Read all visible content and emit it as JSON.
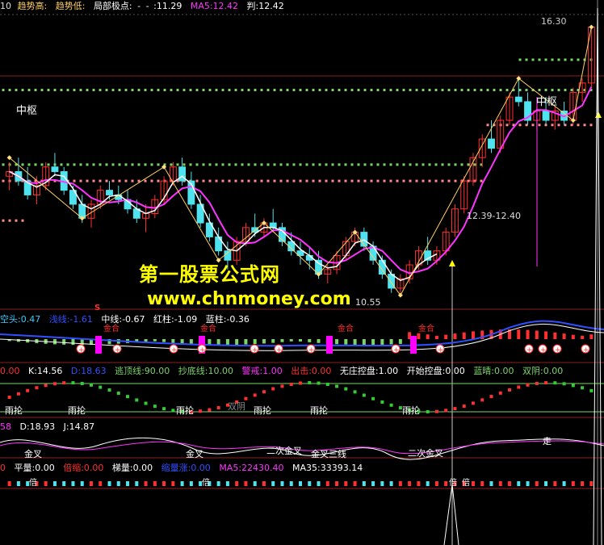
{
  "main_header": {
    "period": "10",
    "trend_high": "趋势高:",
    "trend_low": "趋势低:",
    "local_extreme": "局部极点:",
    "dash": "-",
    "dash2": "-",
    "value1": ":11.29",
    "ma5": "MA5:12.42",
    "judge": "判:12.42"
  },
  "price_labels": {
    "high": "16.30",
    "zhongshu_left": "中枢",
    "zhongshu_right": "中枢",
    "range": "12.39-12.40",
    "low": "10.55"
  },
  "watermark": {
    "cn": "第一股票公式网",
    "url": "www.chnmoney.com"
  },
  "panel2_header": {
    "kongtou": "空头:0.47",
    "qianxian": "浅线:-1.61",
    "zhongxian": "中线:-0.67",
    "hongzhu": "红柱:-1.09",
    "lanzhu": "蓝柱:-0.36",
    "mark": "S",
    "jinhe": "金合"
  },
  "panel3_header": {
    "v0": "0.00",
    "k": "K:14.56",
    "d": "D:18.63",
    "taoding": "逃顶线:90.00",
    "chaodi": "抄底线:10.00",
    "jingjie": "警戒:1.00",
    "chuji": "出击:0.00",
    "wuzhuang": "无庄控盘:1.00",
    "kaishi": "开始控盘:0.00",
    "lanqing": "蓝晴:0.00",
    "shuangyin": "双阴:0.00",
    "yulun": "雨抡",
    "shuangyin_label": "双阴"
  },
  "panel4_header": {
    "v": "58",
    "d": "D:18.93",
    "j": "J:14.87",
    "jincha": "金叉",
    "erci": "二次金叉",
    "zou": "走",
    "sanxian": "金叉三线"
  },
  "panel5_header": {
    "v": "0",
    "pingliang": "平量:0.00",
    "beiliang": "倍缩:0.00",
    "tiliang": "梯量:0.00",
    "suoliang": "缩量涨:0.00",
    "ma5": "MA5:22430.40",
    "ma35": "MA35:33393.14",
    "bei": "倍"
  },
  "colors": {
    "up": "#ff3030",
    "down": "#4fe3ef",
    "ma": "#ff33ff",
    "white_line": "#ffffff",
    "dot_green": "#7cd36a",
    "dot_pink": "#ff8a8a",
    "gold": "#ffd060",
    "yellow": "#ffff00",
    "magenta": "#ff00ff",
    "blue": "#3050ff",
    "grid": "#8a2020"
  },
  "chart_data": [
    {
      "type": "candlestick",
      "series": [
        {
          "values": [
            [
              13.1,
              13.4,
              12.8,
              13.2
            ],
            [
              13.2,
              13.5,
              12.9,
              13.0
            ],
            [
              13.0,
              13.3,
              12.6,
              12.7
            ],
            [
              12.7,
              13.1,
              12.5,
              12.9
            ],
            [
              12.9,
              13.4,
              12.8,
              13.3
            ],
            [
              13.3,
              13.6,
              13.1,
              13.2
            ],
            [
              13.2,
              13.3,
              12.7,
              12.8
            ],
            [
              12.8,
              12.9,
              12.4,
              12.5
            ],
            [
              12.5,
              12.7,
              12.1,
              12.2
            ],
            [
              12.2,
              12.6,
              12.0,
              12.5
            ],
            [
              12.5,
              12.9,
              12.4,
              12.8
            ],
            [
              12.8,
              13.0,
              12.6,
              12.7
            ],
            [
              12.7,
              12.9,
              12.5,
              12.6
            ],
            [
              12.6,
              12.8,
              12.3,
              12.4
            ],
            [
              12.4,
              12.6,
              12.1,
              12.2
            ],
            [
              12.2,
              12.5,
              11.9,
              12.3
            ],
            [
              12.3,
              12.7,
              12.2,
              12.6
            ],
            [
              12.6,
              13.1,
              12.5,
              13.0
            ],
            [
              13.0,
              13.4,
              12.9,
              13.3
            ],
            [
              13.3,
              13.5,
              12.9,
              13.0
            ],
            [
              13.0,
              13.2,
              12.4,
              12.5
            ],
            [
              12.5,
              12.7,
              12.0,
              12.1
            ],
            [
              12.1,
              12.3,
              11.7,
              11.8
            ],
            [
              11.8,
              12.0,
              11.4,
              11.5
            ],
            [
              11.5,
              11.7,
              11.1,
              11.3
            ],
            [
              11.3,
              11.8,
              11.2,
              11.7
            ],
            [
              11.7,
              12.1,
              11.6,
              12.0
            ],
            [
              12.0,
              12.3,
              11.8,
              11.9
            ],
            [
              11.9,
              12.2,
              11.8,
              12.1
            ],
            [
              12.1,
              12.4,
              11.9,
              12.0
            ],
            [
              12.0,
              12.1,
              11.6,
              11.7
            ],
            [
              11.7,
              11.9,
              11.4,
              11.5
            ],
            [
              11.5,
              11.7,
              11.2,
              11.4
            ],
            [
              11.4,
              11.6,
              11.1,
              11.3
            ],
            [
              11.3,
              11.5,
              10.9,
              11.0
            ],
            [
              11.0,
              11.2,
              10.8,
              11.1
            ],
            [
              11.1,
              11.5,
              11.0,
              11.4
            ],
            [
              11.4,
              11.8,
              11.3,
              11.7
            ],
            [
              11.7,
              12.0,
              11.6,
              11.9
            ],
            [
              11.9,
              12.0,
              11.5,
              11.6
            ],
            [
              11.6,
              11.7,
              11.2,
              11.3
            ],
            [
              11.3,
              11.4,
              10.9,
              11.0
            ],
            [
              11.0,
              11.1,
              10.6,
              10.7
            ],
            [
              10.7,
              11.0,
              10.55,
              10.9
            ],
            [
              10.9,
              11.3,
              10.8,
              11.2
            ],
            [
              11.2,
              11.6,
              11.1,
              11.5
            ],
            [
              11.5,
              11.8,
              11.2,
              11.3
            ],
            [
              11.3,
              11.6,
              11.2,
              11.5
            ],
            [
              11.5,
              12.0,
              11.4,
              11.9
            ],
            [
              11.9,
              12.5,
              11.8,
              12.4
            ],
            [
              12.4,
              13.1,
              12.3,
              13.0
            ],
            [
              13.0,
              13.6,
              12.9,
              13.5
            ],
            [
              13.5,
              14.0,
              13.3,
              13.9
            ],
            [
              13.9,
              14.3,
              13.6,
              13.7
            ],
            [
              13.7,
              14.4,
              13.6,
              14.3
            ],
            [
              14.3,
              14.9,
              14.2,
              14.8
            ],
            [
              14.8,
              15.2,
              14.6,
              14.7
            ],
            [
              14.7,
              14.9,
              14.2,
              14.3
            ],
            [
              14.3,
              14.6,
              14.1,
              14.5
            ],
            [
              14.5,
              14.8,
              14.2,
              14.3
            ],
            [
              14.3,
              14.6,
              14.1,
              14.5
            ],
            [
              14.5,
              14.7,
              14.2,
              14.3
            ],
            [
              14.3,
              15.0,
              14.2,
              14.9
            ],
            [
              14.9,
              15.2,
              14.7,
              15.1
            ],
            [
              15.1,
              16.3,
              15.0,
              16.3
            ]
          ]
        }
      ],
      "overlays": [
        "MA5",
        "trend-line",
        "中枢"
      ]
    }
  ]
}
